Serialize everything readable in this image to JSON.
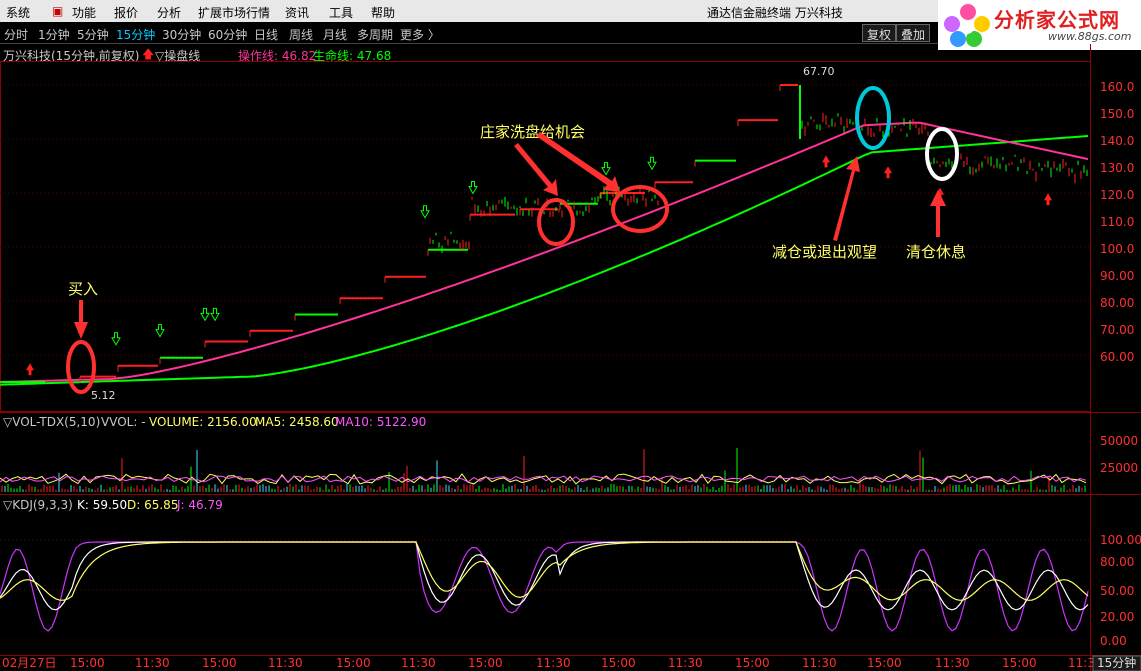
{
  "menu": [
    "系统",
    "功能",
    "报价",
    "分析",
    "扩展市场行情",
    "资讯",
    "工具",
    "帮助"
  ],
  "window_title": "通达信金融终端  万兴科技",
  "logo": {
    "text": "分析家公式网",
    "url": "www.88gs.com"
  },
  "periods": [
    "分时",
    "1分钟",
    "5分钟",
    "15分钟",
    "30分钟",
    "60分钟",
    "日线",
    "周线",
    "月线",
    "多周期",
    "更多 〉"
  ],
  "active_period": "15分钟",
  "toolbar_buttons": [
    "复权",
    "叠加"
  ],
  "main_header": {
    "stock": "万兴科技(15分钟,前复权)",
    "indicator": "▽操盘线",
    "line1": "操作线: 46.82",
    "line2": "生命线: 47.68"
  },
  "price_axis": [
    "160.0",
    "150.0",
    "140.0",
    "130.0",
    "120.0",
    "110.0",
    "100.0",
    "90.00",
    "80.00",
    "70.00",
    "60.00"
  ],
  "annotations": {
    "high": "67.70",
    "low": "5.12",
    "buy": "买入",
    "wash": "庄家洗盘给机会",
    "reduce": "减仓或退出观望",
    "clear": "清仓休息"
  },
  "vol_header": {
    "name": "▽VOL-TDX(5,10)",
    "vvol": "VVOL: -",
    "volume": "VOLUME: 2156.00",
    "ma5": "MA5: 2458.60",
    "ma10": "MA10: 5122.90"
  },
  "vol_axis": [
    "50000",
    "25000"
  ],
  "kdj_header": {
    "name": "▽KDJ(9,3,3)",
    "k": "K: 59.50",
    "d": "D: 65.85",
    "j": "J: 46.79"
  },
  "kdj_axis": [
    "100.00",
    "80.00",
    "50.00",
    "20.00",
    "0.00"
  ],
  "time_axis": [
    "02月27日",
    "15:00",
    "11:30",
    "15:00",
    "11:30",
    "15:00",
    "11:30",
    "15:00",
    "11:30",
    "15:00",
    "11:30",
    "15:00",
    "11:30",
    "15:00",
    "11:30",
    "15:00",
    "11:3"
  ],
  "period_label": "15分钟",
  "colors": {
    "operation_line": "#ff3399",
    "life_line": "#00ff00",
    "red": "#ff2020",
    "cyan_circle": "#00c8d8",
    "white_circle": "#ffffff"
  }
}
